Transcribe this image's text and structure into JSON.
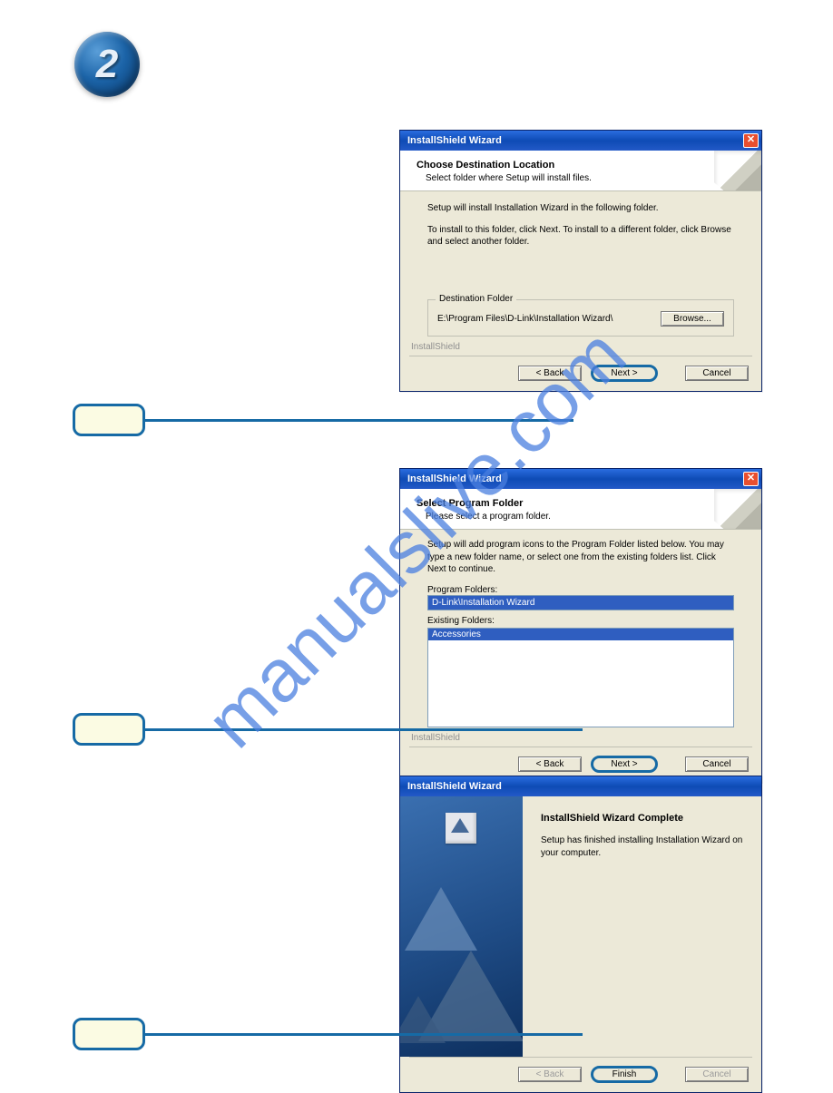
{
  "step_number": "2",
  "watermark": "manualslive.com",
  "dialog1": {
    "title": "InstallShield Wizard",
    "header_title": "Choose Destination Location",
    "header_sub": "Select folder where Setup will install files.",
    "line1": "Setup will install Installation Wizard in the following folder.",
    "line2": "To install to this folder, click Next. To install to a different folder, click Browse and select another folder.",
    "group_legend": "Destination Folder",
    "path": "E:\\Program Files\\D-Link\\Installation Wizard\\",
    "browse": "Browse...",
    "brand": "InstallShield",
    "back": "< Back",
    "next": "Next >",
    "cancel": "Cancel"
  },
  "dialog2": {
    "title": "InstallShield Wizard",
    "header_title": "Select Program Folder",
    "header_sub": "Please select a program folder.",
    "instr": "Setup will add program icons to the Program Folder listed below. You may type a new folder name, or select one from the existing folders list. Click Next to continue.",
    "label_program": "Program Folders:",
    "value_program": "D-Link\\Installation Wizard",
    "label_existing": "Existing Folders:",
    "existing_item": "Accessories",
    "brand": "InstallShield",
    "back": "< Back",
    "next": "Next >",
    "cancel": "Cancel"
  },
  "dialog3": {
    "title": "InstallShield Wizard",
    "complete_title": "InstallShield Wizard Complete",
    "complete_text": "Setup has finished installing Installation Wizard on your computer.",
    "back": "< Back",
    "finish": "Finish",
    "cancel": "Cancel"
  }
}
